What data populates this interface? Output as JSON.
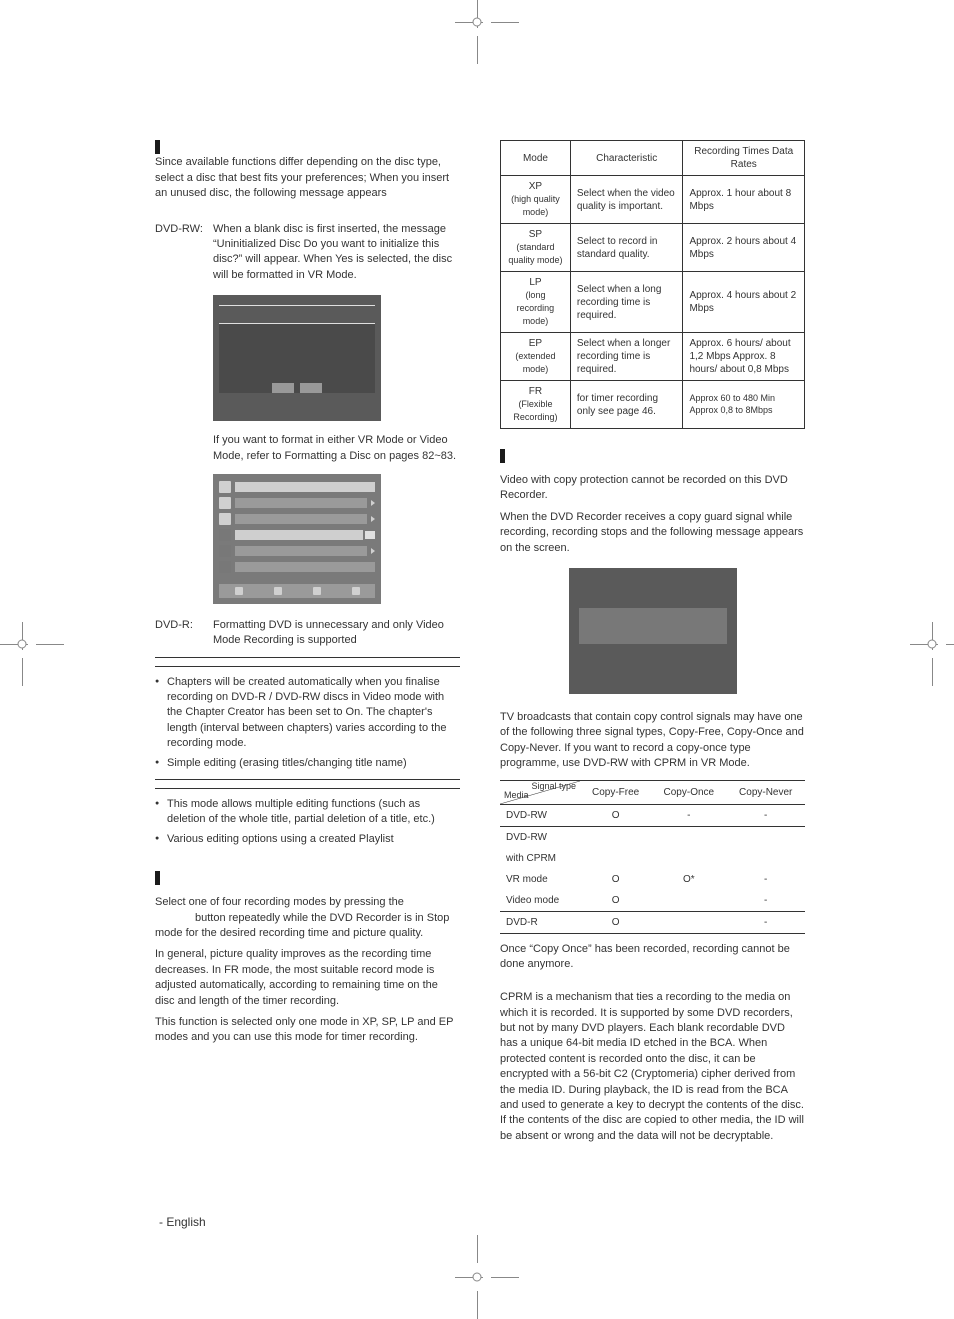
{
  "left": {
    "intro": "Since available functions differ depending on the disc type, select a disc that best fits your preferences; When you insert an unused disc, the following message appears",
    "dvdrw_label": "DVD-RW:",
    "dvdrw_text": "When a blank disc is first inserted, the message “Uninitialized Disc Do you want to initialize this disc?” will appear. When Yes is selected, the disc will be formatted in VR Mode.",
    "vr_note": "If you want to format in either VR Mode or Video Mode, refer to Formatting a Disc on pages 82~83.",
    "dvdr_label": "DVD-R:",
    "dvdr_text": "Formatting DVD is unnecessary and only Video Mode Recording is supported",
    "video_mode_bullets": [
      "Chapters will be created automatically when you finalise recording on DVD-R / DVD-RW discs in Video mode with the Chapter Creator has been set to On. The chapter's length (interval between chapters) varies according to the recording mode.",
      "Simple editing (erasing titles/changing title name)"
    ],
    "vr_mode_bullets": [
      "This mode allows multiple editing functions (such as deletion of the whole title, partial deletion of a title, etc.)",
      "Various editing options using a created Playlist"
    ],
    "rec_intro1": "Select one of four recording modes by pressing the",
    "rec_intro2": "button repeatedly while the DVD Recorder is in Stop mode for the desired recording time and picture quality.",
    "rec_intro3": "In general, picture quality improves as the recording time decreases. In FR mode, the most suitable record mode is adjusted automatically, according to remaining time on the disc and length of the timer recording.",
    "rec_intro4": "This function is selected only one mode in XP, SP, LP and EP modes and you can use this mode for timer recording."
  },
  "modes_table": {
    "headers": [
      "Mode",
      "Characteristic",
      "Recording Times Data Rates"
    ],
    "rows": [
      {
        "mode": "XP",
        "sub": "(high quality mode)",
        "char": "Select when the video quality is important.",
        "rt": "Approx. 1 hour about 8 Mbps"
      },
      {
        "mode": "SP",
        "sub": "(standard quality mode)",
        "char": "Select to record in standard quality.",
        "rt": "Approx. 2 hours about 4 Mbps"
      },
      {
        "mode": "LP",
        "sub": "(long recording mode)",
        "char": "Select when a long recording time is required.",
        "rt": "Approx. 4 hours about 2 Mbps"
      },
      {
        "mode": "EP",
        "sub": "(extended mode)",
        "char": "Select when a longer recording time is required.",
        "rt": "Approx. 6 hours/ about 1,2 Mbps Approx. 8 hours/ about 0,8 Mbps"
      },
      {
        "mode": "FR",
        "sub": "(Flexible Recording)",
        "char": "for timer recording only see page 46.",
        "rt": "Approx 60 to 480 Min Approx 0,8 to 8Mbps"
      }
    ]
  },
  "right": {
    "copy_protect1": "Video with copy protection cannot be recorded on this DVD Recorder.",
    "copy_protect2": "When the DVD Recorder receives a copy guard signal while recording, recording stops and the following message appears on the screen.",
    "signals_para": "TV broadcasts that contain copy control signals may have one of the following three signal types, Copy-Free, Copy-Once and Copy-Never. If you want to record a copy-once type programme, use DVD-RW with CPRM in VR Mode.",
    "once_note": "Once “Copy Once” has been recorded, recording cannot be done anymore.",
    "cprm_para": "CPRM is a mechanism that ties a recording to the media on which it is recorded. It is supported by some DVD recorders, but not by many DVD players. Each blank recordable DVD has a unique 64-bit media ID etched in the BCA. When protected content is recorded onto the disc, it can be encrypted with a 56-bit C2 (Cryptomeria) cipher derived from the media ID. During playback, the ID is read from the BCA and used to generate a key to decrypt the contents of the disc. If the contents of the disc are copied to other media, the ID will be absent or wrong and the data will not be decryptable."
  },
  "copy_table": {
    "diag_top": "Signal type",
    "diag_bottom": "Media",
    "headers": [
      "Copy-Free",
      "Copy-Once",
      "Copy-Never"
    ],
    "rows": [
      {
        "media": "DVD-RW",
        "free": "O",
        "once": "-",
        "never": "-"
      },
      {
        "media": "DVD-RW",
        "free": "",
        "once": "",
        "never": ""
      },
      {
        "media": "with CPRM",
        "free": "",
        "once": "",
        "never": ""
      },
      {
        "media": "VR mode",
        "free": "O",
        "once": "O*",
        "never": "-"
      },
      {
        "media": "Video mode",
        "free": "O",
        "once": "",
        "never": "-"
      },
      {
        "media": "DVD-R",
        "free": "O",
        "once": "",
        "never": "-"
      }
    ]
  },
  "footer": {
    "lang": "- English"
  }
}
